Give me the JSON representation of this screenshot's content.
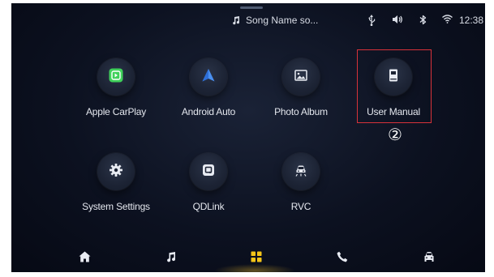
{
  "status_bar": {
    "now_playing": "Song Name so...",
    "time": "12:38",
    "icons": [
      "music-note-icon",
      "usb-icon",
      "volume-icon",
      "bluetooth-icon",
      "wifi-icon"
    ]
  },
  "apps": [
    {
      "label": "Apple CarPlay",
      "icon": "carplay-icon",
      "icon_color": "#3fd15a"
    },
    {
      "label": "Android Auto",
      "icon": "android-auto-icon",
      "icon_color": "#4a90f0"
    },
    {
      "label": "Photo Album",
      "icon": "photo-icon",
      "icon_color": "#e8ebf2"
    },
    {
      "label": "User Manual",
      "icon": "manual-icon",
      "icon_color": "#e8ebf2"
    },
    {
      "label": "System Settings",
      "icon": "gear-icon",
      "icon_color": "#e8ebf2"
    },
    {
      "label": "QDLink",
      "icon": "qdlink-icon",
      "icon_color": "#e8ebf2"
    },
    {
      "label": "RVC",
      "icon": "rear-camera-icon",
      "icon_color": "#e8ebf2"
    }
  ],
  "callout": {
    "marker": "②",
    "highlight_color": "#d8323a"
  },
  "dock": {
    "items": [
      "home-icon",
      "music-icon",
      "apps-grid-icon",
      "phone-icon",
      "car-icon"
    ],
    "active_item": "apps-grid-icon",
    "active_color": "#f5c518"
  }
}
